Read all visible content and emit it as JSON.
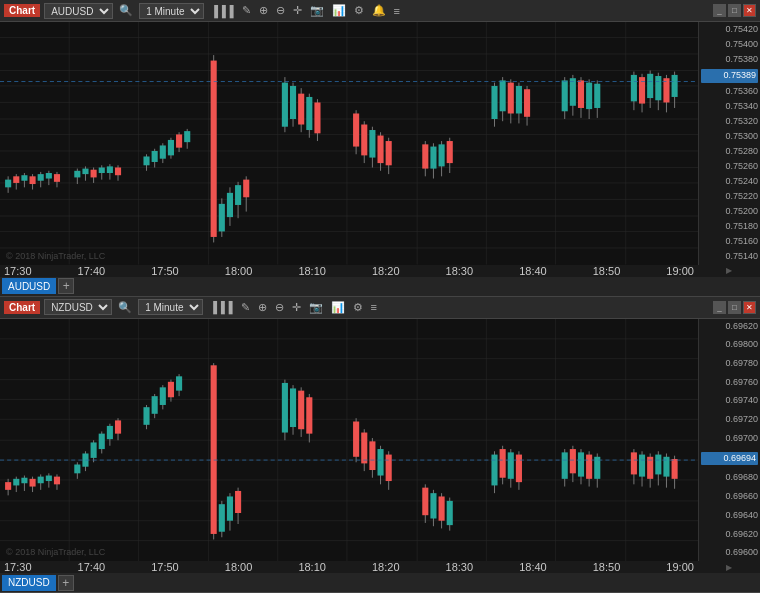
{
  "chart1": {
    "label": "Chart",
    "symbol": "AUDUSD",
    "timeframe": "1 Minute",
    "prices": [
      "0.75420",
      "0.75400",
      "0.75380",
      "0.75360",
      "0.75340",
      "0.75320",
      "0.75300",
      "0.75280",
      "0.75260",
      "0.75240",
      "0.75220",
      "0.75200",
      "0.75180",
      "0.75160",
      "0.75140"
    ],
    "current_price": "0.75389",
    "times": [
      "17:30",
      "17:40",
      "17:50",
      "18:00",
      "18:10",
      "18:20",
      "18:30",
      "18:40",
      "18:50",
      "19:00"
    ],
    "copyright": "© 2018 NinjaTrader, LLC",
    "tab": "AUDUSD"
  },
  "chart2": {
    "label": "Chart",
    "symbol": "NZDUSD",
    "timeframe": "1 Minute",
    "prices": [
      "0.69620",
      "0.69600",
      "0.69780",
      "0.69760",
      "0.69740",
      "0.69720",
      "0.69700",
      "0.69680",
      "0.69660",
      "0.69640",
      "0.69620",
      "0.69600"
    ],
    "current_price": "0.69694",
    "times": [
      "17:30",
      "17:40",
      "17:50",
      "18:00",
      "18:10",
      "18:20",
      "18:30",
      "18:40",
      "18:50",
      "19:00"
    ],
    "copyright": "© 2018 NinjaTrader, LLC",
    "tab": "NZDUSD"
  },
  "toolbar": {
    "chart_label": "Chart",
    "timeframe_label": "1 Minute",
    "add_tab": "+"
  },
  "window": {
    "minimize": "_",
    "restore": "□",
    "close": "✕"
  }
}
